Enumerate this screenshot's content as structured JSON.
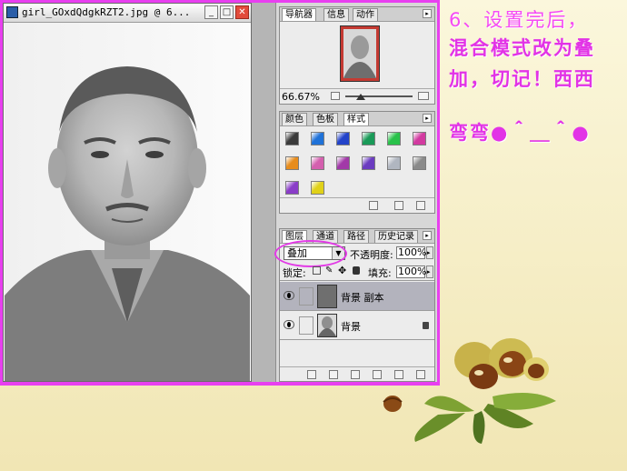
{
  "document": {
    "title": "girl_GOxdQdgkRZT2.jpg @ 6...",
    "window_buttons": {
      "minimize": "_",
      "maximize": "□",
      "close": "✕"
    }
  },
  "navigator_panel": {
    "tabs": [
      "导航器",
      "信息",
      "动作"
    ],
    "zoom": "66.67%"
  },
  "styles_panel": {
    "tabs": [
      "颜色",
      "色板",
      "样式"
    ],
    "swatch_colors": [
      "#3b3b3b",
      "#1f72d8",
      "#2343c9",
      "#1a9a58",
      "#29c24a",
      "#d23aa0",
      "#e78c1c",
      "#d45fae",
      "#a239a8",
      "#6b3cc0",
      "#b0b6c0",
      "#8a8a8a",
      "#8a3dc8",
      "#e0d118"
    ]
  },
  "layers_panel": {
    "tabs": [
      "图层",
      "通道",
      "路径",
      "历史记录"
    ],
    "blend_mode": "叠加",
    "opacity_label": "不透明度:",
    "opacity_value": "100%",
    "lock_label": "锁定:",
    "fill_label": "填充:",
    "fill_value": "100%",
    "layers": [
      {
        "name": "背景 副本",
        "selected": true
      },
      {
        "name": "背景",
        "selected": false
      }
    ]
  },
  "annotation": {
    "line1": "6、设置完后，",
    "line2": "混合模式改为叠",
    "line3": "加，切记！西西",
    "line4": "弯弯●＾＿＾●"
  },
  "colors": {
    "frame": "#e83ff0",
    "annotation_text": "#e233e6",
    "background": "#f6efc9"
  }
}
